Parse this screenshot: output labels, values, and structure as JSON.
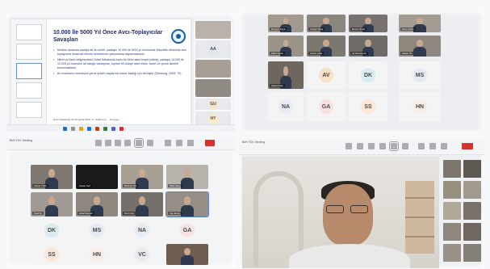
{
  "slide": {
    "title": "10.000 İle 5000 Yıl Önce Avcı-Toplayıcılar Savaşları",
    "bullets": [
      "Modern anlamda savaşa ait ilk veriler, yaklaşık 10.000 ile 5000 yıl öncesinde Mezolitik dönemde avcı toplayıcılar arasında ölümle neticelenen çatışmalara dayanmaktadır.",
      "Nitref ve Batılı bölgesindeki Cebel Sahaba'da toplu bir ölüm alanı tespit edilmiş; yaklaşık 14.000 ile 12.000 yıl öncesine ait olduğu varsayılan, toplam 59 dolaylı adet erkek, kadın ve çocuk iskeleti bulunmaktadır.",
      "Bu insanların neredeyse yarısı şiddet olaylarına maruz kaldığı için ölmüştür (Ginsburg, 2009: 79)"
    ],
    "footer": "Emil Dülderhağ: 23.10 Şubat 2019 - K. Sabiha ve ... Kongresi"
  },
  "top_left_strip": [
    {
      "kind": "video",
      "label": ""
    },
    {
      "kind": "avatar",
      "initials": "AA"
    },
    {
      "kind": "video",
      "label": ""
    },
    {
      "kind": "video",
      "label": ""
    },
    {
      "kind": "avatar",
      "initials": "GU"
    },
    {
      "kind": "avatar",
      "initials": "HY"
    }
  ],
  "top_right_grid": {
    "video_labels": [
      "Meryem Kaya",
      "Cengiz Aktaş",
      "Murat Yılmaz",
      "Emre Şahin",
      "Şükrü Aydın",
      "Kenan Çelik",
      "Ali Rıza Demir",
      "Hakan Öz",
      "Seda Arslan"
    ],
    "avatars": [
      "AV",
      "DK",
      "MS",
      "NA",
      "GA",
      "SS",
      "HN"
    ],
    "avatar_colors": [
      "#f6e0c8",
      "#d8eef3",
      "#e4e9f2",
      "#e7ebf3",
      "#f7e1e1",
      "#f9e7d8",
      "#f9eee8"
    ]
  },
  "bottom_left_grid": {
    "title": "BMYYDK Meeting",
    "video_labels": [
      "Ahmet Yıldız",
      "Hasan Kurt",
      "Mehmet Tan",
      "Sibel Aksoy",
      "Kadir Er",
      "Erdal Sancak",
      "Mert Uçar",
      "Can Ersoy"
    ],
    "avatars": [
      "DK",
      "MS",
      "NA",
      "GA",
      "SS",
      "HN",
      "VC"
    ],
    "avatar_colors": [
      "#dcecf0",
      "#e6ebf3",
      "#e8ecf3",
      "#f7e3e3",
      "#f9e8d9",
      "#fbeee6",
      "#e9eaf2"
    ]
  },
  "bottom_right": {
    "title": "BMYYDK Meeting",
    "toolbar_label": "Meeting"
  }
}
